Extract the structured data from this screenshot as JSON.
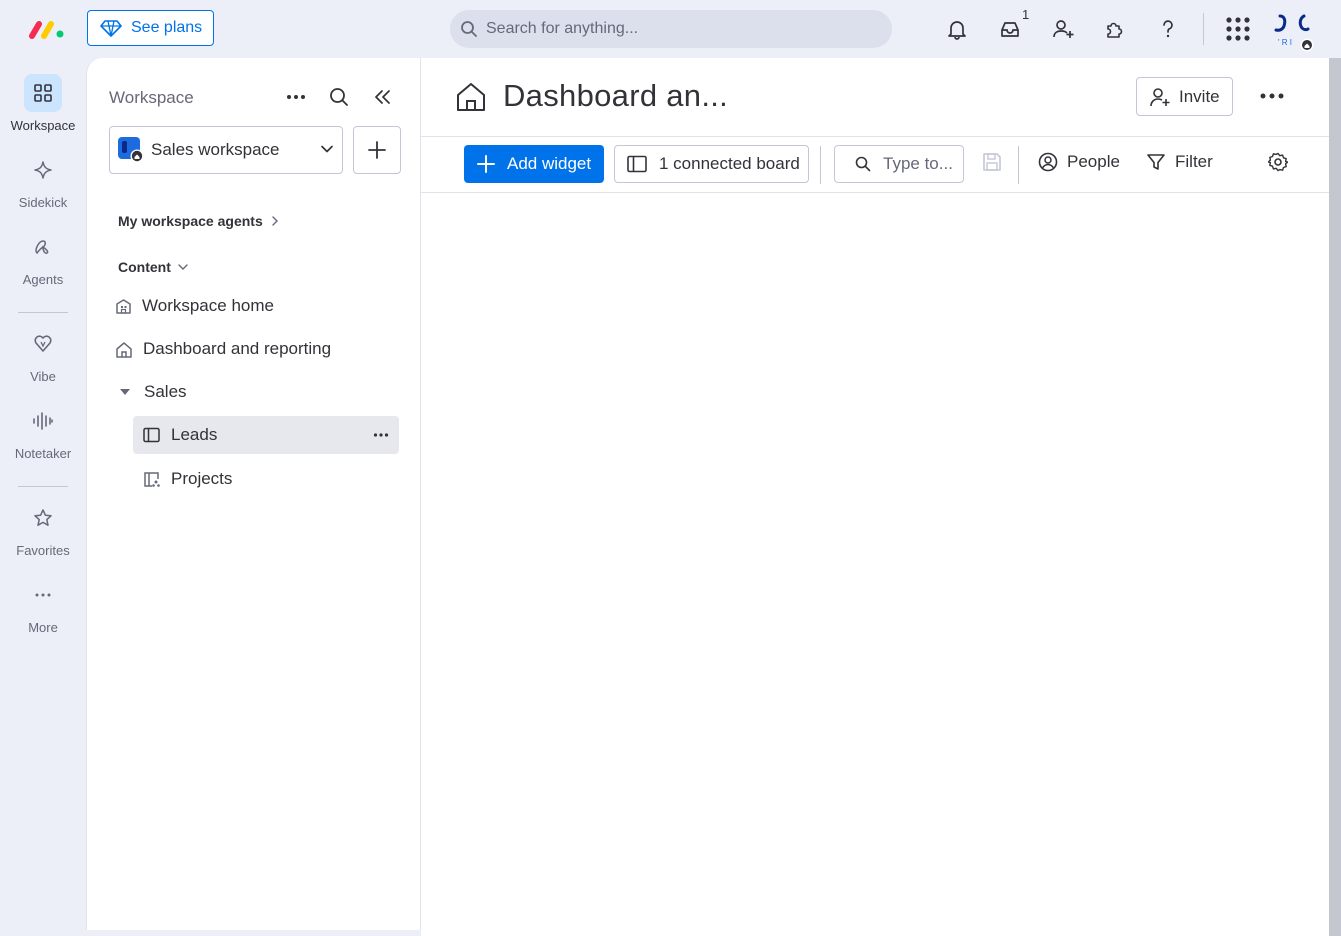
{
  "topbar": {
    "see_plans_label": "See plans",
    "search_placeholder": "Search for anything...",
    "inbox_badge": "1",
    "avatar_initials": "' R I"
  },
  "rail": {
    "items": [
      {
        "label": "Workspace"
      },
      {
        "label": "Sidekick"
      },
      {
        "label": "Agents"
      },
      {
        "label": "Vibe"
      },
      {
        "label": "Notetaker"
      },
      {
        "label": "Favorites"
      },
      {
        "label": "More"
      }
    ]
  },
  "panel": {
    "title": "Workspace",
    "workspace_name": "Sales workspace",
    "agents_label": "My workspace agents",
    "content_label": "Content",
    "items": [
      {
        "label": "Workspace home"
      },
      {
        "label": "Dashboard and reporting"
      },
      {
        "label": "Sales"
      },
      {
        "label": "Leads"
      },
      {
        "label": "Projects"
      }
    ]
  },
  "main": {
    "title": "Dashboard an...",
    "invite_label": "Invite",
    "toolbar": {
      "add_widget_label": "Add widget",
      "connected_board_label": "1 connected board",
      "type_placeholder": "Type to...",
      "people_label": "People",
      "filter_label": "Filter"
    }
  },
  "colors": {
    "primary": "#0073ea",
    "background": "#eceff8",
    "selected": "#e6e8ee",
    "rail_active": "#cce5ff"
  }
}
